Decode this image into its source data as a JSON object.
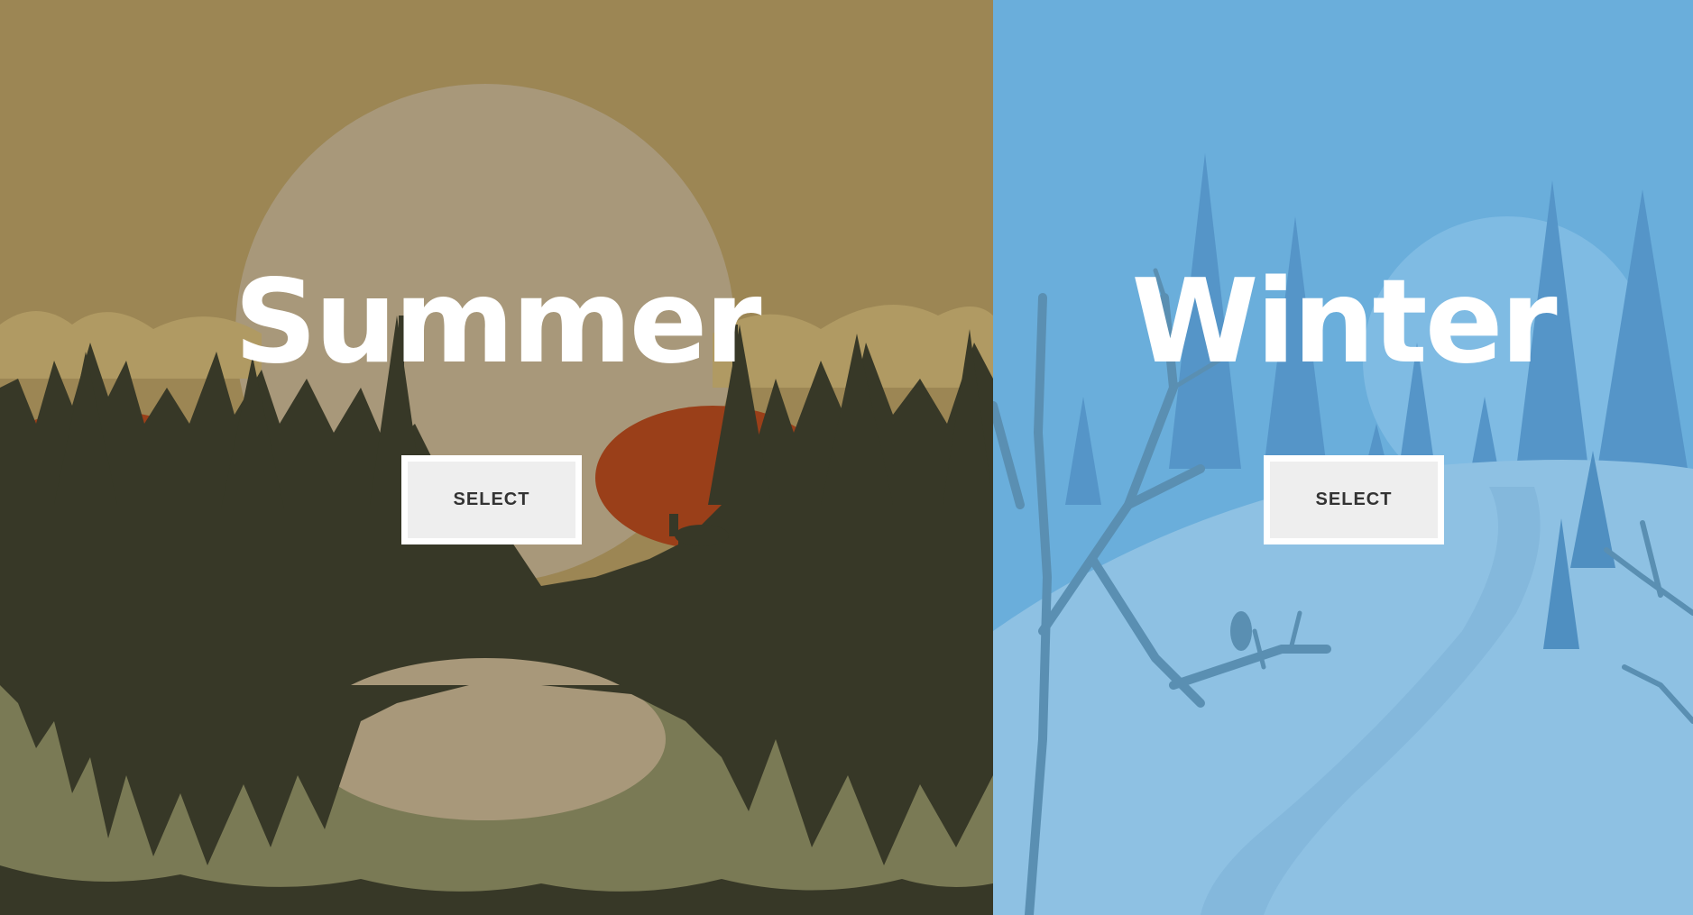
{
  "panels": [
    {
      "title": "Summer",
      "button_label": "SELECT",
      "scene": "forest-lake-sunset",
      "colors": {
        "sky": "#9c8654",
        "sun": "#a8987a",
        "hills": "#9a3f19",
        "forest": "#373827",
        "water": "#7a7a55"
      }
    },
    {
      "title": "Winter",
      "button_label": "SELECT",
      "scene": "snowy-hill-forest",
      "colors": {
        "sky": "#6aaedb",
        "snow": "#8ec1e3",
        "trees": "#4f8fc1",
        "branches": "#5a8fb2"
      }
    }
  ]
}
